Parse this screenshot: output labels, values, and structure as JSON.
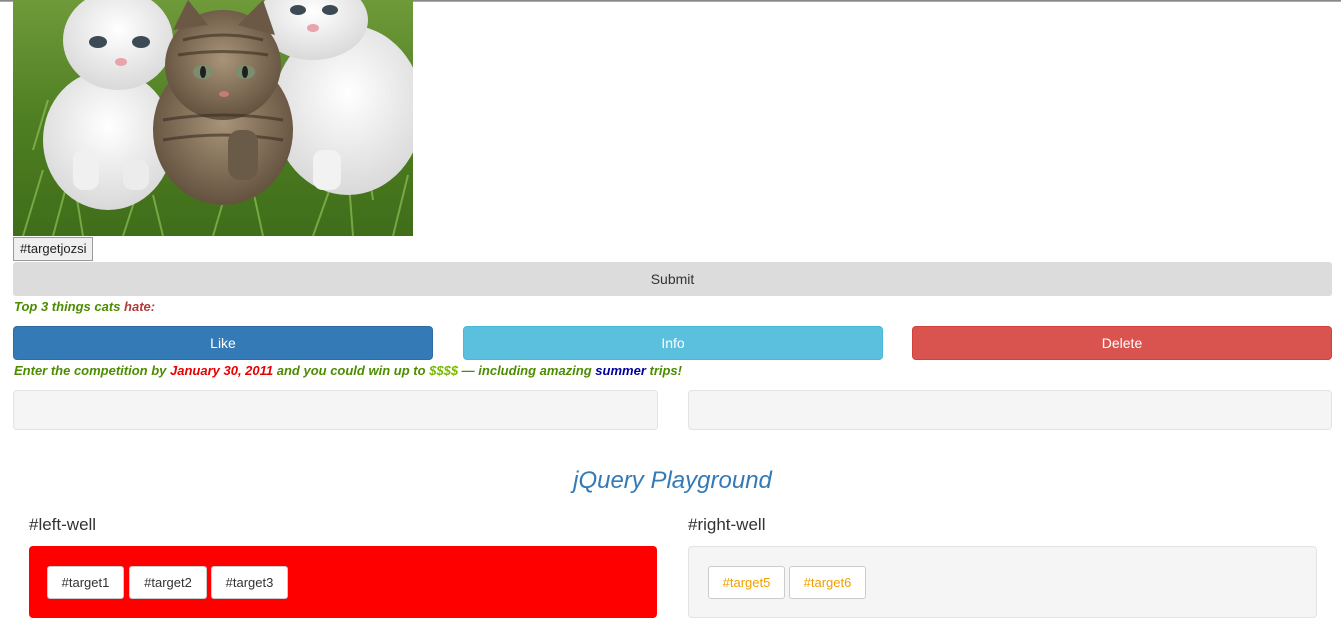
{
  "image": {
    "alt": "kittens-photo"
  },
  "target_jozsi": {
    "label": "#targetjozsi"
  },
  "form": {
    "submit_label": "Submit"
  },
  "cats_hate": {
    "prefix": "Top 3 things cats",
    "emphasis": "hate:"
  },
  "buttons": {
    "like": "Like",
    "info": "Info",
    "delete": "Delete"
  },
  "competition": {
    "part1": "Enter the competition by ",
    "date": "January 30, 2011",
    "part2": " and you could win up to ",
    "money": "$$$$",
    "part3": " — including amazing ",
    "summer": "summer",
    "part4": " trips!"
  },
  "playground": {
    "title": "jQuery Playground",
    "left_well": {
      "label": "#left-well",
      "buttons": [
        "#target1",
        "#target2",
        "#target3"
      ]
    },
    "right_well": {
      "label": "#right-well",
      "buttons": [
        "#target5",
        "#target6"
      ]
    }
  },
  "colors": {
    "primary": "#337ab7",
    "info": "#5bc0de",
    "danger": "#d9534f",
    "left_well_bg": "#ff0000",
    "green_text": "#4c8c00",
    "right_target_text": "#f0a000"
  }
}
